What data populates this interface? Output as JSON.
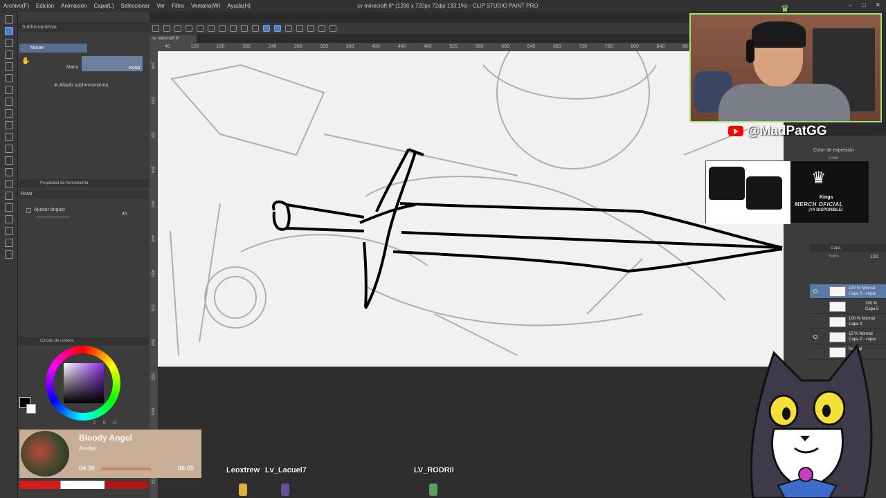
{
  "menu": [
    "Archivo(F)",
    "Edición",
    "Animación",
    "Capa(L)",
    "Seleccionar",
    "Ver",
    "Filtro",
    "Ventana(W)",
    "Ayuda(H)"
  ],
  "window_title": "sv minecraft 8* (1280 x 720px 72dpi 133.1%) - CLIP STUDIO PAINT PRO",
  "window_buttons": [
    "–",
    "□",
    "✕"
  ],
  "left_panel": {
    "subtool_tab": "Subherramienta",
    "active_subtool": "Mover",
    "hand_label": "Mano",
    "rotate_label": "Rotar",
    "add_subtool": "Añadir subherramienta",
    "tool_property_tab": "Propiedad de herramienta",
    "rotate_section": "Rotar",
    "adjust_angle": "Ajustar ángulo",
    "angle_value": "45",
    "color_wheel_tab": "Círculo de colores",
    "color_values": [
      "0",
      "0",
      "0"
    ]
  },
  "canvas": {
    "tab": "sv minecraft 8*",
    "ruler_top": [
      "40",
      "120",
      "160",
      "200",
      "240",
      "280",
      "320",
      "360",
      "400",
      "440",
      "480",
      "520",
      "560",
      "600",
      "640",
      "680",
      "720",
      "760",
      "800",
      "840",
      "88"
    ],
    "ruler_left": [
      "240",
      "280",
      "320",
      "360",
      "400",
      "440",
      "480",
      "520",
      "560",
      "600",
      "640",
      "680",
      "720"
    ]
  },
  "right_panel": {
    "color_expression": "Color de expresión",
    "color_value": "Color",
    "layer_tab": "Capa",
    "blend_mode": "Norm",
    "opacity": "100",
    "layers": [
      {
        "line1": "100 % Normal",
        "line2": "Capa 5 - copia",
        "selected": true
      },
      {
        "line1": "100 %",
        "line2": "Capa 5",
        "selected": false
      },
      {
        "line1": "100 % Normal",
        "line2": "Capa 4",
        "selected": false
      },
      {
        "line1": "15 % Normal",
        "line2": "Capa 2 - copia",
        "selected": false
      },
      {
        "line1": "Normal",
        "line2": "",
        "selected": false
      }
    ]
  },
  "stream": {
    "handle": "@MadPatGG",
    "merch_brand": "Kings",
    "merch_title": "MERCH OFICIAL",
    "merch_sub": "¡YA DISPONIBLE!",
    "now_playing": {
      "song": "Bloody Angel",
      "artist": "Avatar",
      "time_current": "04:20",
      "time_total": "06:05",
      "progress": 0.69
    },
    "viewers": [
      "Leoxtrew",
      "Lv_Lacuel7",
      "LV_RODRII"
    ]
  },
  "colors": {
    "accent_green": "#a4e06d",
    "youtube_red": "#ff0000",
    "selection_blue": "#5b7aa8"
  }
}
